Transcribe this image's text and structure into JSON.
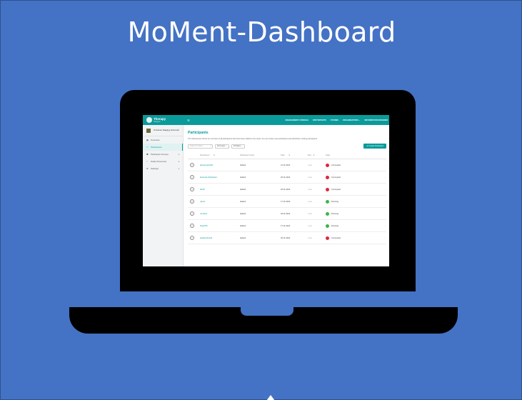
{
  "slide": {
    "title": "MoMent-Dashboard",
    "background": "#4472c4"
  },
  "app": {
    "logo": {
      "name": "Therapy",
      "sub": "Designer"
    },
    "menu_icon": "hamburger-icon",
    "nav": [
      "MANAGEMENT CONSOLE",
      "PARTICIPANTS",
      "STUDIES",
      "ORGANISATIONS ⌄",
      "INFORMATION DESIGNER"
    ],
    "accent": "#0a9a9a"
  },
  "sidebar": {
    "tenant": "Universe Staging (Internal)",
    "items": [
      {
        "label": "Overview",
        "icon": "grid-icon",
        "has_chevron": false,
        "active": false
      },
      {
        "label": "Participants",
        "icon": "person-icon",
        "has_chevron": false,
        "active": true
      },
      {
        "label": "Participant Groups",
        "icon": "group-icon",
        "has_chevron": true,
        "active": false
      },
      {
        "label": "Study Personnel",
        "icon": "share-icon",
        "has_chevron": true,
        "active": false
      },
      {
        "label": "Settings",
        "icon": "gear-icon",
        "has_chevron": true,
        "active": false
      }
    ]
  },
  "main": {
    "title": "Participants",
    "description": "The following list shows an overview of all participants that have been added to the study. You can create new participants and administer existing participants.",
    "search_placeholder": "Search for Partic...",
    "filter_groups": "All Groups ⌄",
    "filter_states": "All States ⌄",
    "create_button": "⊕ Create Participant",
    "columns": [
      "Pseudonym",
      "⇅",
      "Participant Group",
      "Start",
      "⇅",
      "End",
      "⇅",
      "State"
    ],
    "rows": [
      {
        "pseudonym": "2jtvueAndroid2",
        "group": "default",
        "start": "21.11.2022",
        "end": "none",
        "state": "Uncoupled",
        "state_color": "#e0253f"
      },
      {
        "pseudonym": "Example Participant",
        "group": "default",
        "start": "20.11.2022",
        "end": "none",
        "state": "Uncoupled",
        "state_color": "#e0253f"
      },
      {
        "pseudonym": "t4k18",
        "group": "default",
        "start": "18.11.2022",
        "end": "none",
        "state": "Uncoupled",
        "state_color": "#e0253f"
      },
      {
        "pseudonym": "rpfmd",
        "group": "default",
        "start": "17.11.2022",
        "end": "none",
        "state": "Running",
        "state_color": "#3cb54a"
      },
      {
        "pseudonym": "mochine",
        "group": "default",
        "start": "18.11.2022",
        "end": "none",
        "state": "Running",
        "state_color": "#3cb54a"
      },
      {
        "pseudonym": "3irginr05",
        "group": "default",
        "start": "17.11.2022",
        "end": "none",
        "state": "Running",
        "state_color": "#3cb54a"
      },
      {
        "pseudonym": "awa4Android1",
        "group": "default",
        "start": "30.11.2022",
        "end": "none",
        "state": "Uncoupled",
        "state_color": "#e0253f"
      }
    ]
  }
}
